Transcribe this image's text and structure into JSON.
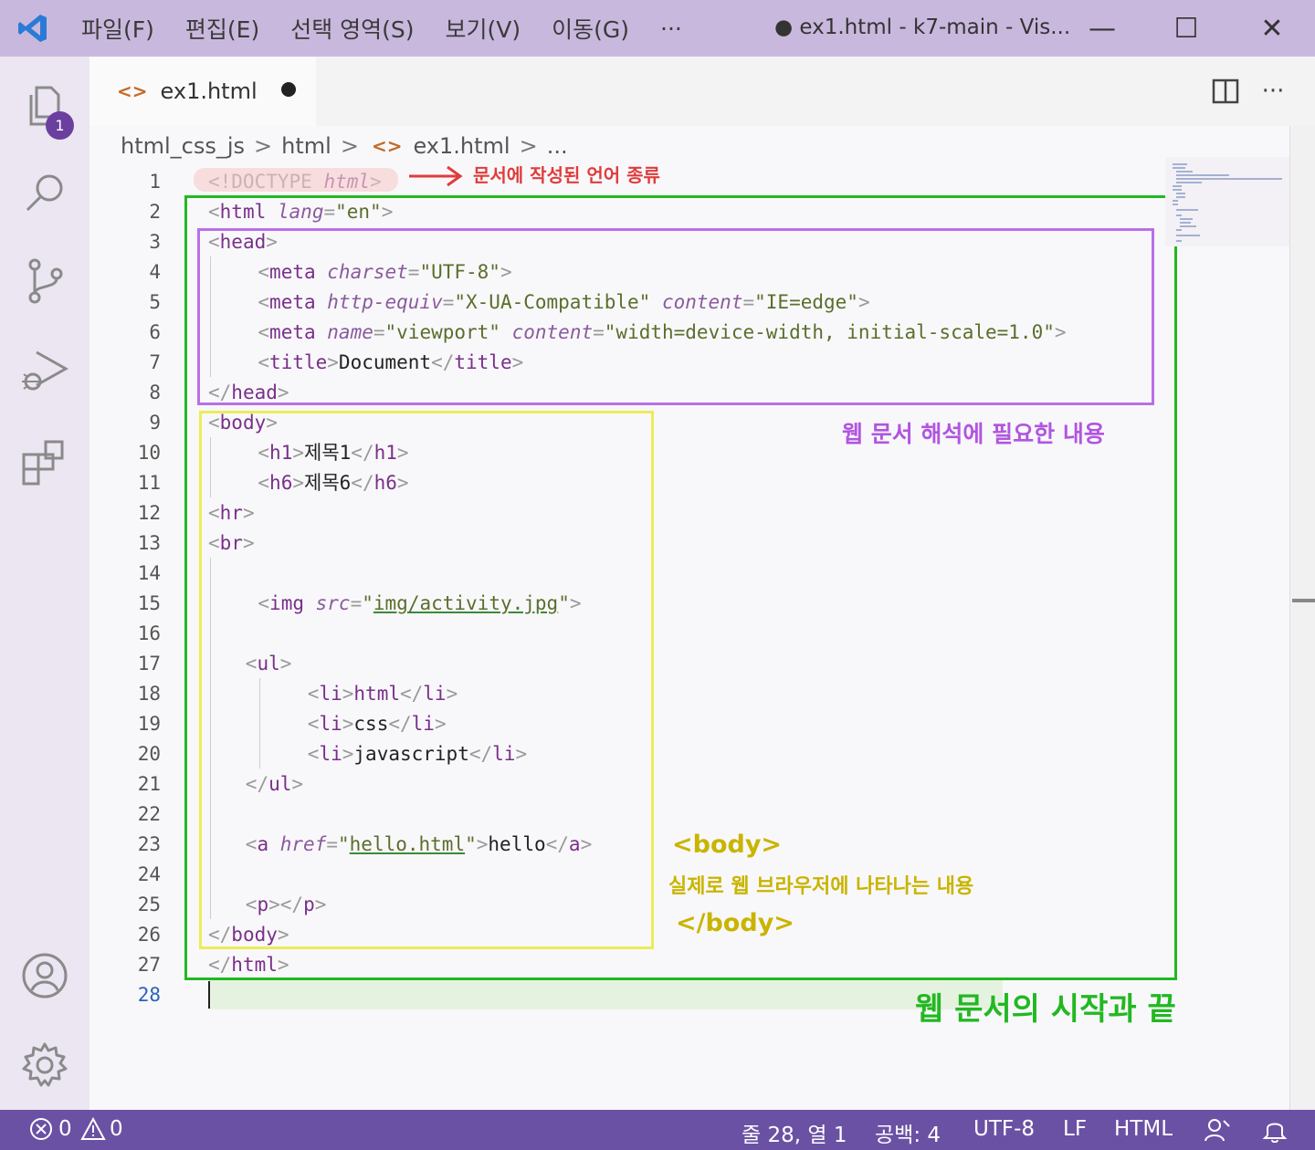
{
  "titlebar": {
    "menus": [
      "파일(F)",
      "편집(E)",
      "선택 영역(S)",
      "보기(V)",
      "이동(G)",
      "···"
    ],
    "title": "● ex1.html - k7-main - Vis...",
    "min": "—",
    "max": "☐",
    "close": "✕"
  },
  "activity": {
    "badge": "1"
  },
  "tab": {
    "icon": "<>",
    "label": "ex1.html"
  },
  "breadcrumb": {
    "parts": [
      "html_css_js",
      "html",
      "ex1.html",
      "..."
    ],
    "icon": "<>"
  },
  "editor": {
    "line_numbers": [
      "1",
      "2",
      "3",
      "4",
      "5",
      "6",
      "7",
      "8",
      "9",
      "10",
      "11",
      "12",
      "13",
      "14",
      "15",
      "16",
      "17",
      "18",
      "19",
      "20",
      "21",
      "22",
      "23",
      "24",
      "25",
      "26",
      "27",
      "28"
    ],
    "lines": [
      [
        "<!DOCTYPE",
        " ",
        "html",
        ">"
      ],
      [
        "<",
        "html",
        " ",
        "lang",
        "=",
        "\"en\"",
        ">"
      ],
      [
        "<",
        "head",
        ">"
      ],
      [
        "<",
        "meta",
        " ",
        "charset",
        "=",
        "\"UTF-8\"",
        ">"
      ],
      [
        "<",
        "meta",
        " ",
        "http-equiv",
        "=",
        "\"X-UA-Compatible\"",
        " ",
        "content",
        "=",
        "\"IE=edge\"",
        ">"
      ],
      [
        "<",
        "meta",
        " ",
        "name",
        "=",
        "\"viewport\"",
        " ",
        "content",
        "=",
        "\"width=device-width, initial-scale=1.0\"",
        ">"
      ],
      [
        "<",
        "title",
        ">",
        "Document",
        "</",
        "title",
        ">"
      ],
      [
        "</",
        "head",
        ">"
      ],
      [
        "<",
        "body",
        ">"
      ],
      [
        "<",
        "h1",
        ">",
        "제목1",
        "</",
        "h1",
        ">"
      ],
      [
        "<",
        "h6",
        ">",
        "제목6",
        "</",
        "h6",
        ">"
      ],
      [
        "<",
        "hr",
        ">"
      ],
      [
        "<",
        "br",
        ">"
      ],
      [],
      [
        "<",
        "img",
        " ",
        "src",
        "=",
        "\"",
        "img/activity.jpg",
        "\"",
        ">"
      ],
      [],
      [
        "<",
        "ul",
        ">"
      ],
      [
        "<",
        "li",
        ">",
        "html",
        "</",
        "li",
        ">"
      ],
      [
        "<",
        "li",
        ">",
        "css",
        "</",
        "li",
        ">"
      ],
      [
        "<",
        "li",
        ">",
        "javascript",
        "</",
        "li",
        ">"
      ],
      [
        "</",
        "ul",
        ">"
      ],
      [],
      [
        "<",
        "a",
        " ",
        "href",
        "=",
        "\"",
        "hello.html",
        "\"",
        ">",
        "hello",
        "</",
        "a",
        ">"
      ],
      [],
      [
        "<",
        "p",
        ">",
        "</",
        "p",
        ">"
      ],
      [
        "</",
        "body",
        ">"
      ],
      [
        "</",
        "html",
        ">"
      ],
      []
    ]
  },
  "annotations": {
    "doctype_note": "문서에 작성된 언어 종류",
    "head_note": "웹 문서 해석에 필요한 내용",
    "body_open": "<body>",
    "body_note": "실제로 웹 브라우저에 나타나는 내용",
    "body_close": "</body>",
    "html_note": "웹 문서의 시작과 끝",
    "colors": {
      "doctype": "#e03c3c",
      "head": "#b155e0",
      "body": "#e6e23a",
      "html": "#22b822"
    }
  },
  "status": {
    "errors": "0",
    "warnings": "0",
    "position": "줄 28, 열 1",
    "spaces": "공백: 4",
    "encoding": "UTF-8",
    "eol": "LF",
    "language": "HTML"
  }
}
